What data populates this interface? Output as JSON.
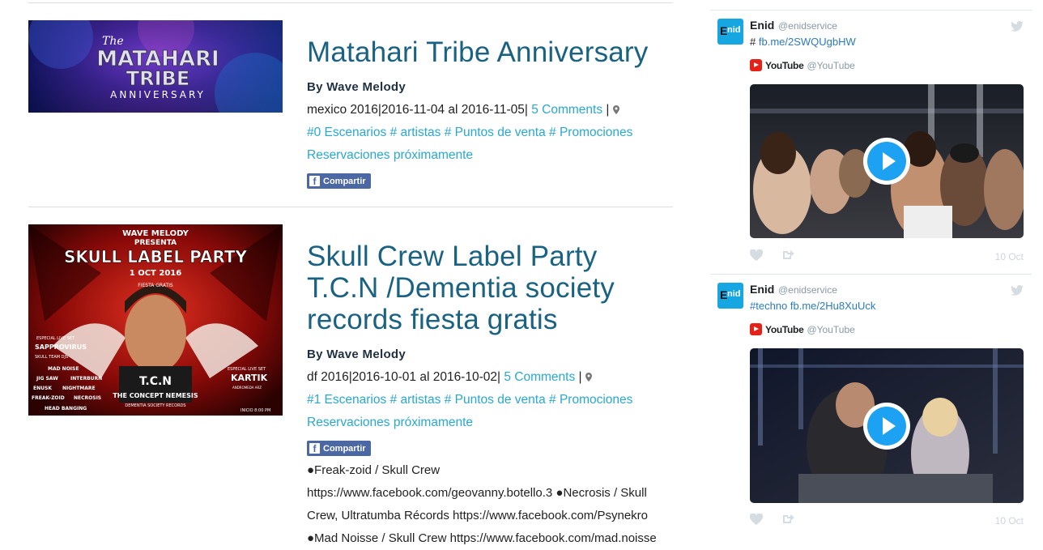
{
  "posts": [
    {
      "title": "Matahari Tribe Anniversary",
      "image_text": {
        "line1": "The",
        "line2": "MATAHARI",
        "line3": "TRIBE",
        "line4": "ANNIVERSARY"
      },
      "author": "By Wave Melody",
      "meta_prefix": "mexico 2016|2016-11-04 al 2016-11-05|",
      "comments": "5 Comments",
      "meta_sep": "|",
      "tags": [
        "#0 Escenarios",
        "# artistas",
        "# Puntos de venta",
        "# Promociones"
      ],
      "reservations": "Reservaciones próximamente",
      "share_label": "Compartir"
    },
    {
      "title": "Skull Crew Label Party T.C.N /Dementia society records fiesta gratis",
      "image_text": {
        "header": "WAVE MELODY",
        "presenta": "PRESENTA",
        "party": "SKULL LABEL PARTY",
        "date": "1 OCT 2016",
        "fiesta": "FIESTA GRATIS",
        "live_left": "ESPECIAL LIVE SET",
        "artist_left": "SAPPROVIRUS",
        "team": "SKULL TEAM DJS",
        "left_list": [
          "MAD NOISE",
          "JIG SAW",
          "INTERBURN",
          "ENUSK",
          "NIGHTMARE",
          "FREAK-ZOID",
          "NECROSIS",
          "HEAD BANGING"
        ],
        "live_right": "ESPECIAL LIVE SET",
        "artist_right": "KARTIK",
        "artist_right_sub": "ANDROMEDA ARZ",
        "tcn": "T.C.N",
        "concept": "THE CONCEPT NEMESIS",
        "records": "DEMENTIA SOCIETY RECORDS",
        "inicio": "INICIO 8:00 PM"
      },
      "author": "By Wave Melody",
      "meta_prefix": "df 2016|2016-10-01 al 2016-10-02|",
      "comments": "5 Comments",
      "meta_sep": "|",
      "tags": [
        "#1 Escenarios",
        "# artistas",
        "# Puntos de venta",
        "# Promociones"
      ],
      "reservations": "Reservaciones próximamente",
      "share_label": "Compartir",
      "description": "●Freak-zoid / Skull Crew https://www.facebook.com/geovanny.botello.3 ●Necrosis / Skull Crew, Ultratumba Récords https://www.facebook.com/Psynekro ●Mad Noisse / Skull Crew https://www.facebook.com/mad.noisse"
    }
  ],
  "tweets": [
    {
      "avatar": {
        "e": "E",
        "n": "nid"
      },
      "name": "Enid",
      "handle": "@enidservice",
      "text_prefix": "#",
      "link": "fb.me/2SWQUgbHW",
      "yt_name": "YouTube",
      "yt_handle": "@YouTube",
      "date": "10 Oct"
    },
    {
      "avatar": {
        "e": "E",
        "n": "nid"
      },
      "name": "Enid",
      "handle": "@enidservice",
      "text_prefix": "#techno",
      "link": "fb.me/2Hu8XuUck",
      "yt_name": "YouTube",
      "yt_handle": "@YouTube",
      "date": "10 Oct"
    }
  ],
  "colors": {
    "title": "#1a6282",
    "link": "#29a8d0",
    "share_bg": "#4c68a4",
    "twitter_blue": "#1da1f2",
    "youtube_red": "#e62117"
  },
  "icons": [
    "map-marker-icon",
    "facebook-icon",
    "twitter-bird-icon",
    "youtube-icon",
    "play-icon",
    "heart-icon",
    "share-icon"
  ]
}
